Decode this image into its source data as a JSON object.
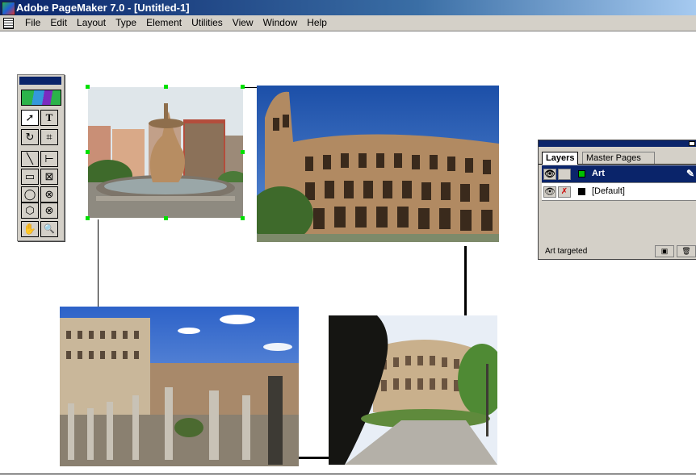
{
  "window": {
    "title": "Adobe PageMaker 7.0 - [Untitled-1]"
  },
  "menu": [
    "File",
    "Edit",
    "Layout",
    "Type",
    "Element",
    "Utilities",
    "View",
    "Window",
    "Help"
  ],
  "toolbox": {
    "tools": [
      {
        "name": "pointer-tool",
        "glyph": "➚",
        "active": true
      },
      {
        "name": "text-tool",
        "glyph": "T"
      },
      {
        "name": "rotate-tool",
        "glyph": "↻"
      },
      {
        "name": "crop-tool",
        "glyph": "⌗"
      },
      {
        "name": "line-tool",
        "glyph": "╲"
      },
      {
        "name": "constrained-line-tool",
        "glyph": "⊢"
      },
      {
        "name": "rectangle-tool",
        "glyph": "▭"
      },
      {
        "name": "rectangle-frame-tool",
        "glyph": "⊠"
      },
      {
        "name": "ellipse-tool",
        "glyph": "◯"
      },
      {
        "name": "ellipse-frame-tool",
        "glyph": "⊗"
      },
      {
        "name": "polygon-tool",
        "glyph": "⬡"
      },
      {
        "name": "polygon-frame-tool",
        "glyph": "⊗"
      },
      {
        "name": "hand-tool",
        "glyph": "✋"
      },
      {
        "name": "zoom-tool",
        "glyph": "🔍"
      }
    ]
  },
  "layers_panel": {
    "tabs": [
      "Layers",
      "Master Pages"
    ],
    "active_tab": "Layers",
    "layers": [
      {
        "name": "Art",
        "color": "#00c000",
        "selected": true
      },
      {
        "name": "[Default]",
        "color": "#000000",
        "selected": false
      }
    ],
    "status": "Art targeted"
  },
  "colors": {
    "titlebar": "#0a246a",
    "chrome": "#d4d0c8",
    "selection_handle": "#00e000"
  }
}
